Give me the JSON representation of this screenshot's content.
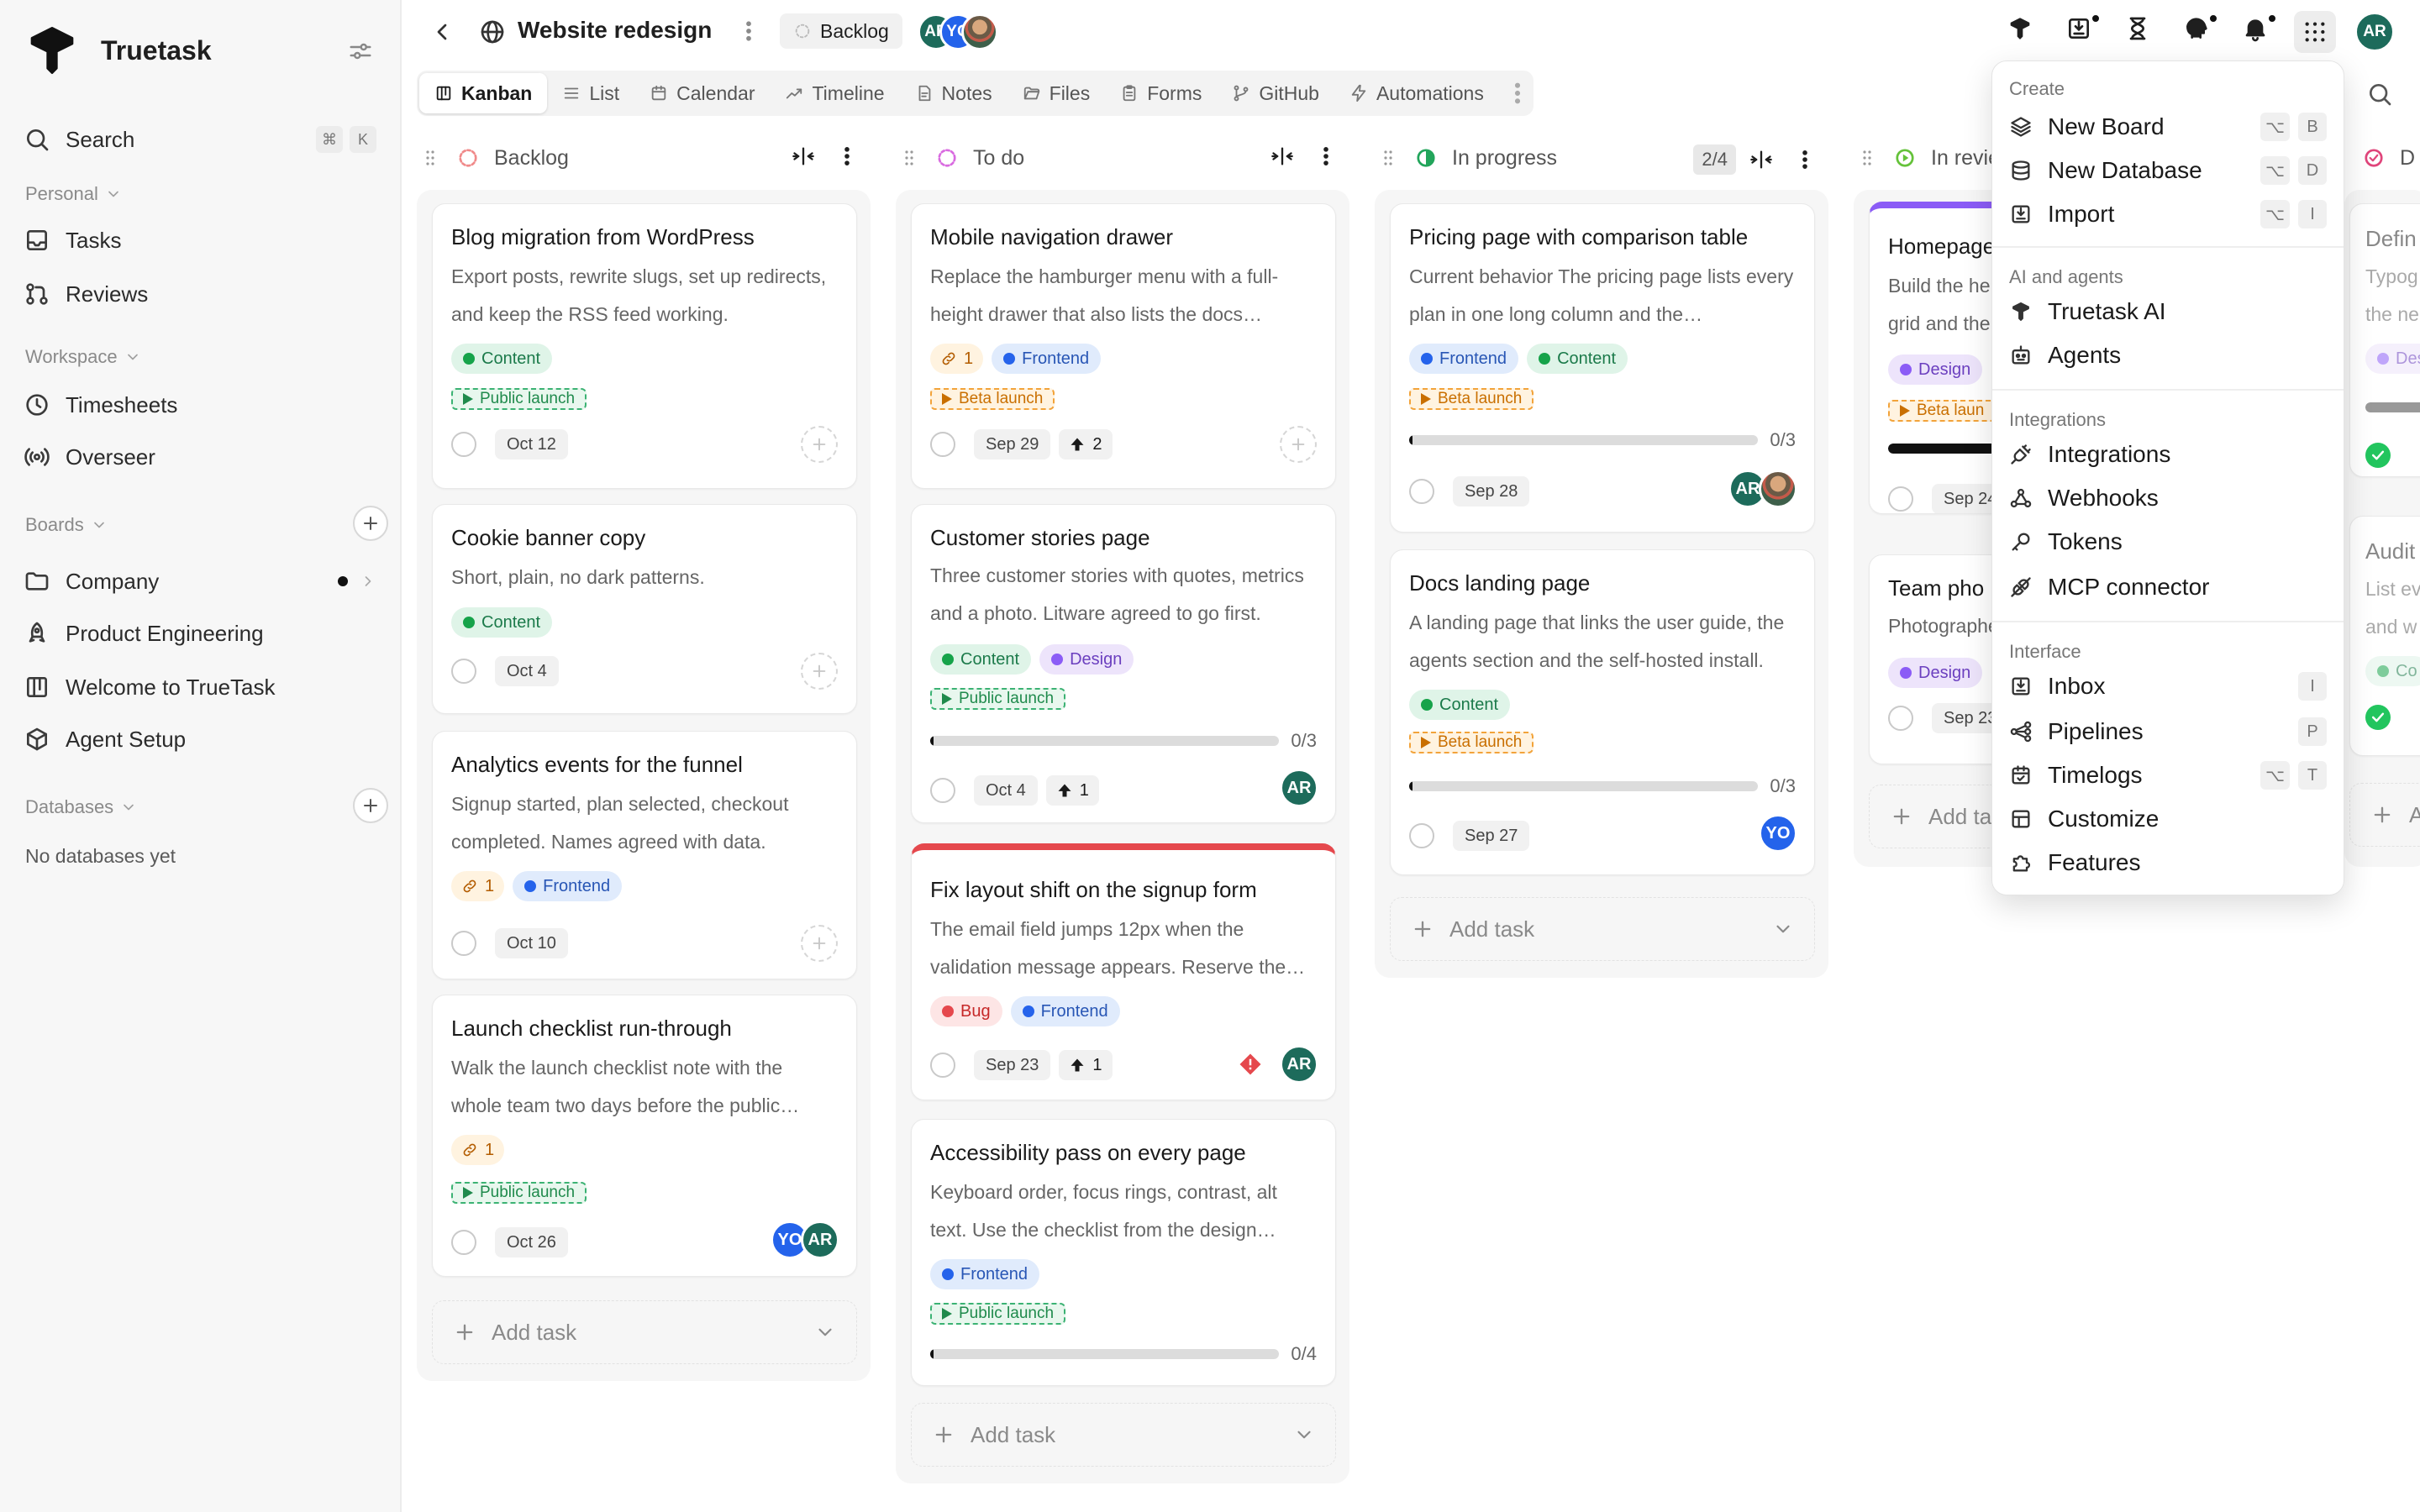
{
  "sidebar": {
    "app_name": "Truetask",
    "search": {
      "label": "Search",
      "keys": [
        "⌘",
        "K"
      ]
    },
    "personal": {
      "title": "Personal",
      "items": [
        "Tasks",
        "Reviews"
      ]
    },
    "workspace": {
      "title": "Workspace",
      "items": [
        "Timesheets",
        "Overseer"
      ]
    },
    "boards": {
      "title": "Boards",
      "items": [
        "Company",
        "Product Engineering",
        "Welcome to TrueTask",
        "Agent Setup"
      ]
    },
    "databases": {
      "title": "Databases",
      "empty": "No databases yet"
    }
  },
  "header": {
    "title": "Website redesign",
    "status": "Backlog",
    "avatars": [
      "AR",
      "YO"
    ],
    "user_initials": "AR"
  },
  "tabs": [
    "Kanban",
    "List",
    "Calendar",
    "Timeline",
    "Notes",
    "Files",
    "Forms",
    "GitHub",
    "Automations"
  ],
  "columns": [
    {
      "name": "Backlog",
      "add_label": "Add task",
      "cards": [
        {
          "title": "Blog migration from WordPress",
          "desc": "Export posts, rewrite slugs, set up redirects, and keep the RSS feed working.",
          "tags": [
            "Content"
          ],
          "milestone": "Public launch",
          "date": "Oct 12"
        },
        {
          "title": "Cookie banner copy",
          "desc": "Short, plain, no dark patterns.",
          "tags": [
            "Content"
          ],
          "date": "Oct 4"
        },
        {
          "title": "Analytics events for the funnel",
          "desc": "Signup started, plan selected, checkout completed. Names agreed with data.",
          "links": "1",
          "tags": [
            "Frontend"
          ],
          "date": "Oct 10"
        },
        {
          "title": "Launch checklist run-through",
          "desc": "Walk the launch checklist note with the whole team two days before the public…",
          "links": "1",
          "milestone": "Public launch",
          "date": "Oct 26",
          "avatars": [
            "YO",
            "AR"
          ]
        }
      ]
    },
    {
      "name": "To do",
      "add_label": "Add task",
      "cards": [
        {
          "title": "Mobile navigation drawer",
          "desc": "Replace the hamburger menu with a full-height drawer that also lists the docs…",
          "links": "1",
          "tags": [
            "Frontend"
          ],
          "milestone": "Beta launch",
          "date": "Sep 29",
          "votes": "2"
        },
        {
          "title": "Customer stories page",
          "desc": "Three customer stories with quotes, metrics and a photo. Litware agreed to go first.",
          "tags": [
            "Content",
            "Design"
          ],
          "milestone": "Public launch",
          "progress": "0/3",
          "date": "Oct 4",
          "votes": "1",
          "avatars": [
            "AR"
          ]
        },
        {
          "title": "Fix layout shift on the signup form",
          "desc": "The email field jumps 12px when the validation message appears. Reserve the…",
          "tags": [
            "Bug",
            "Frontend"
          ],
          "date": "Sep 23",
          "votes": "1",
          "avatars": [
            "AR"
          ]
        },
        {
          "title": "Accessibility pass on every page",
          "desc": "Keyboard order, focus rings, contrast, alt text. Use the checklist from the design…",
          "tags": [
            "Frontend"
          ],
          "milestone": "Public launch",
          "progress": "0/4"
        }
      ]
    },
    {
      "name": "In progress",
      "count": "2/4",
      "add_label": "Add task",
      "cards": [
        {
          "title": "Pricing page with comparison table",
          "desc": "Current behavior The pricing page lists every plan in one long column and the…",
          "tags": [
            "Frontend",
            "Content"
          ],
          "milestone": "Beta launch",
          "progress": "0/3",
          "date": "Sep 28",
          "avatars": [
            "AR"
          ]
        },
        {
          "title": "Docs landing page",
          "desc": "A landing page that links the user guide, the agents section and the self-hosted install.",
          "tags": [
            "Content"
          ],
          "milestone": "Beta launch",
          "progress": "0/3",
          "date": "Sep 27",
          "avatars": [
            "YO"
          ]
        }
      ]
    },
    {
      "name": "In revie",
      "add_label": "Add ta",
      "cards": [
        {
          "title": "Homepage",
          "desc_lines": [
            "Build the he",
            "grid and the"
          ],
          "tags": [
            "Design"
          ],
          "milestone": "Beta laun",
          "date": "Sep 24"
        },
        {
          "title": "Team pho",
          "desc_lines": [
            "Photographe"
          ],
          "tags": [
            "Design"
          ],
          "date": "Sep 23"
        }
      ]
    },
    {
      "name": "D",
      "add_label": "A",
      "cards": [
        {
          "title": "Defin",
          "desc_lines": [
            "Typog",
            "the ne"
          ],
          "tags": [
            "Des"
          ]
        },
        {
          "title": "Audit",
          "desc_lines": [
            "List ev",
            "and w"
          ],
          "tags": [
            "Co"
          ]
        }
      ]
    }
  ],
  "menu": {
    "sections": [
      {
        "title": "Create",
        "items": [
          {
            "label": "New Board",
            "keys": [
              "⌥",
              "B"
            ],
            "icon": "layers-icon"
          },
          {
            "label": "New Database",
            "keys": [
              "⌥",
              "D"
            ],
            "icon": "database-icon"
          },
          {
            "label": "Import",
            "keys": [
              "⌥",
              "I"
            ],
            "icon": "import-icon"
          }
        ]
      },
      {
        "title": "AI and agents",
        "items": [
          {
            "label": "Truetask AI",
            "icon": "truetask-logo-icon"
          },
          {
            "label": "Agents",
            "icon": "robot-icon"
          }
        ]
      },
      {
        "title": "Integrations",
        "items": [
          {
            "label": "Integrations",
            "icon": "plug-icon"
          },
          {
            "label": "Webhooks",
            "icon": "webhook-icon"
          },
          {
            "label": "Tokens",
            "icon": "key-icon"
          },
          {
            "label": "MCP connector",
            "icon": "connector-icon"
          }
        ]
      },
      {
        "title": "Interface",
        "items": [
          {
            "label": "Inbox",
            "keys": [
              "I"
            ],
            "icon": "inbox-icon"
          },
          {
            "label": "Pipelines",
            "keys": [
              "P"
            ],
            "icon": "pipeline-icon"
          },
          {
            "label": "Timelogs",
            "keys": [
              "⌥",
              "T"
            ],
            "icon": "timelog-icon"
          },
          {
            "label": "Customize",
            "icon": "layout-icon"
          },
          {
            "label": "Features",
            "icon": "puzzle-icon"
          }
        ]
      }
    ]
  },
  "colors": {
    "accent_dark": "#111111",
    "avatar_ar": "#1d6b5b",
    "avatar_yo": "#2463eb",
    "bug": "#e5484d",
    "design": "#8b5cf6",
    "content": "#16a34a",
    "frontend": "#2563eb"
  }
}
